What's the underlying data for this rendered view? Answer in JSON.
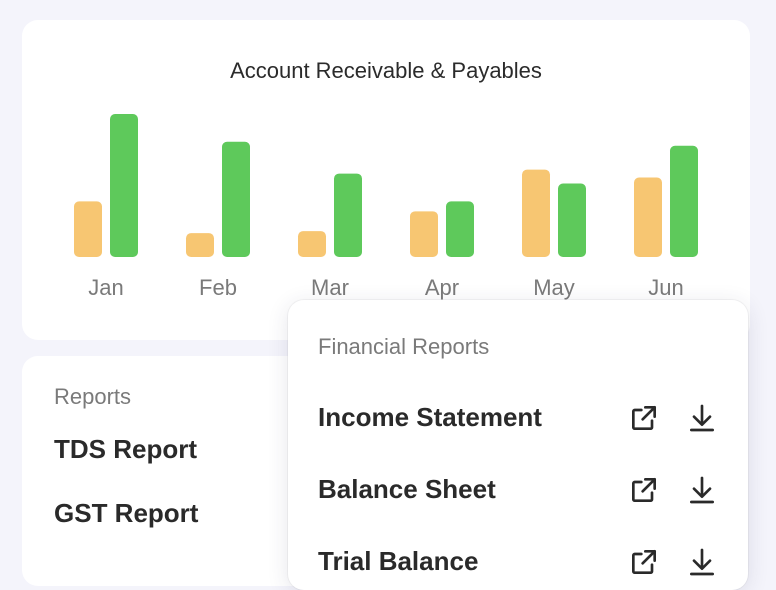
{
  "chart_card": {
    "title": "Account Receivable & Payables"
  },
  "chart_data": {
    "type": "bar",
    "title": "Account Receivable & Payables",
    "categories": [
      "Jan",
      "Feb",
      "Mar",
      "Apr",
      "May",
      "Jun"
    ],
    "series": [
      {
        "color": "#f7c672",
        "values": [
          28,
          12,
          13,
          23,
          44,
          40
        ]
      },
      {
        "color": "#5ec95b",
        "values": [
          72,
          58,
          42,
          28,
          37,
          56
        ]
      }
    ],
    "ylim": [
      0,
      72
    ],
    "grid": false,
    "legend": "none"
  },
  "reports_card": {
    "heading": "Reports",
    "items": [
      {
        "label": "TDS Report"
      },
      {
        "label": "GST Report"
      }
    ]
  },
  "financial_reports": {
    "heading": "Financial Reports",
    "items": [
      {
        "label": "Income Statement",
        "open_icon": "external-link-icon",
        "download_icon": "download-icon"
      },
      {
        "label": "Balance Sheet",
        "open_icon": "external-link-icon",
        "download_icon": "download-icon"
      },
      {
        "label": "Trial Balance",
        "open_icon": "external-link-icon",
        "download_icon": "download-icon"
      }
    ]
  }
}
